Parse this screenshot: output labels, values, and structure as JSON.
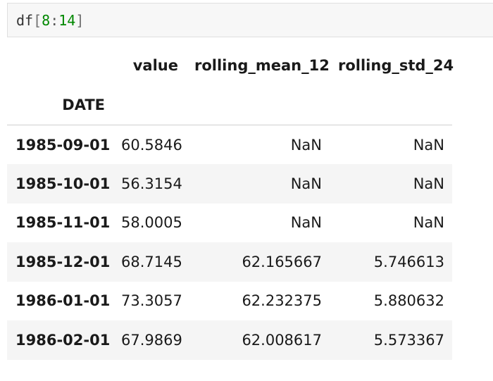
{
  "input": {
    "name": "df",
    "open_bracket": "[",
    "start": "8",
    "colon": ":",
    "stop": "14",
    "close_bracket": "]"
  },
  "table": {
    "columns": [
      "value",
      "rolling_mean_12",
      "rolling_std_24"
    ],
    "index_name": "DATE",
    "rows": [
      {
        "index": "1985-09-01",
        "value": "60.5846",
        "rolling_mean_12": "NaN",
        "rolling_std_24": "NaN"
      },
      {
        "index": "1985-10-01",
        "value": "56.3154",
        "rolling_mean_12": "NaN",
        "rolling_std_24": "NaN"
      },
      {
        "index": "1985-11-01",
        "value": "58.0005",
        "rolling_mean_12": "NaN",
        "rolling_std_24": "NaN"
      },
      {
        "index": "1985-12-01",
        "value": "68.7145",
        "rolling_mean_12": "62.165667",
        "rolling_std_24": "5.746613"
      },
      {
        "index": "1986-01-01",
        "value": "73.3057",
        "rolling_mean_12": "62.232375",
        "rolling_std_24": "5.880632"
      },
      {
        "index": "1986-02-01",
        "value": "67.9869",
        "rolling_mean_12": "62.008617",
        "rolling_std_24": "5.573367"
      }
    ]
  },
  "colors": {
    "cell_background": "#f7f7f7",
    "number_color": "#008800",
    "row_stripe": "#f5f5f5"
  }
}
